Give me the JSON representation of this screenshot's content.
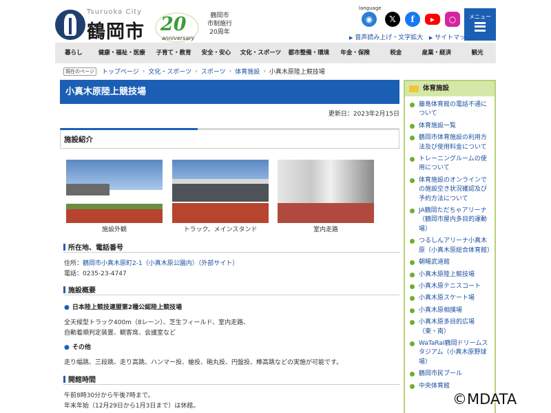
{
  "header": {
    "logo_en": "Tsuruoka City",
    "logo_ja": "鶴岡市",
    "anniversary_number": "20",
    "anniversary_word": "anniversary",
    "anniversary_text_lines": [
      "鶴岡市",
      "市制施行",
      "20周年"
    ],
    "language_label": "language",
    "util_links": [
      "音声読み上げ・文字拡大",
      "サイトマップ"
    ],
    "menu_label": "メニュー"
  },
  "icons": {
    "language": "globe-icon",
    "x": "x-icon",
    "facebook": "facebook-icon",
    "youtube": "youtube-icon",
    "instagram": "instagram-icon",
    "menu": "hamburger-icon"
  },
  "gnav": [
    "暮らし",
    "健康・福祉・医療",
    "子育て・教育",
    "安全・安心",
    "文化・スポーツ",
    "都市整備・環境",
    "年金・保険",
    "税金",
    "産業・経済",
    "観光"
  ],
  "breadcrumb": {
    "here": "現在のページ",
    "items": [
      "トップページ",
      "文化・スポーツ",
      "スポーツ",
      "体育施設",
      "小真木原陸上競技場"
    ]
  },
  "page": {
    "title": "小真木原陸上競技場",
    "updated": "更新日：2023年2月15日",
    "section_title": "施設紹介",
    "photos": [
      "施設外観",
      "トラック、メインスタンド",
      "室内走路"
    ],
    "location_head": "所在地、電話番号",
    "address_prefix": "住所：",
    "address_link": "鶴岡市小真木原町2-1（小真木原公園内）（外部サイト）",
    "phone": "電話：0235-23-4747",
    "overview_head": "施設概要",
    "bullet1": "日本陸上競技連盟第2種公認陸上競技場",
    "bullet1_text1": "全天候型トラック400m（8レーン）、芝生フィールド、室内走路、",
    "bullet1_text2": "自動着順判定装置、観客席、会議室など",
    "bullet2": "その他",
    "bullet2_text": "走り幅跳、三段跳、走り高跳、ハンマー投、槍投、砲丸投、円盤投、棒高跳などの実施が可能です。",
    "hours_head": "開館時間",
    "hours_text1": "午前8時30分から午後7時まで。",
    "hours_text2": "年末年始（12月29日から1月3日まで）は休館。"
  },
  "sidebar": {
    "title": "体育施設",
    "items": [
      "藤島体育館の電話不通について",
      "体育施設一覧",
      "鶴岡市体育施設の利用方法及び使用料金について",
      "トレーニングルームの使用について",
      "体育施設のオンラインでの施設空き状況確認及び予約方法について",
      "JA鶴岡ただちゃアリーナ（鶴岡市屋内多目的運動場）",
      "つるしんアリーナ小真木原（小真木原総合体育館）",
      "朝暘武道館",
      "小真木原陸上競技場",
      "小真木原テニスコート",
      "小真木原スケート場",
      "小真木原相撲場",
      "小真木原多目的広場（東・南）",
      "WaTaRaI鶴岡ドリームスタジアム（小真木原野球場）",
      "鶴岡市民プール",
      "中央体育館"
    ]
  },
  "watermark": "©MDATA"
}
